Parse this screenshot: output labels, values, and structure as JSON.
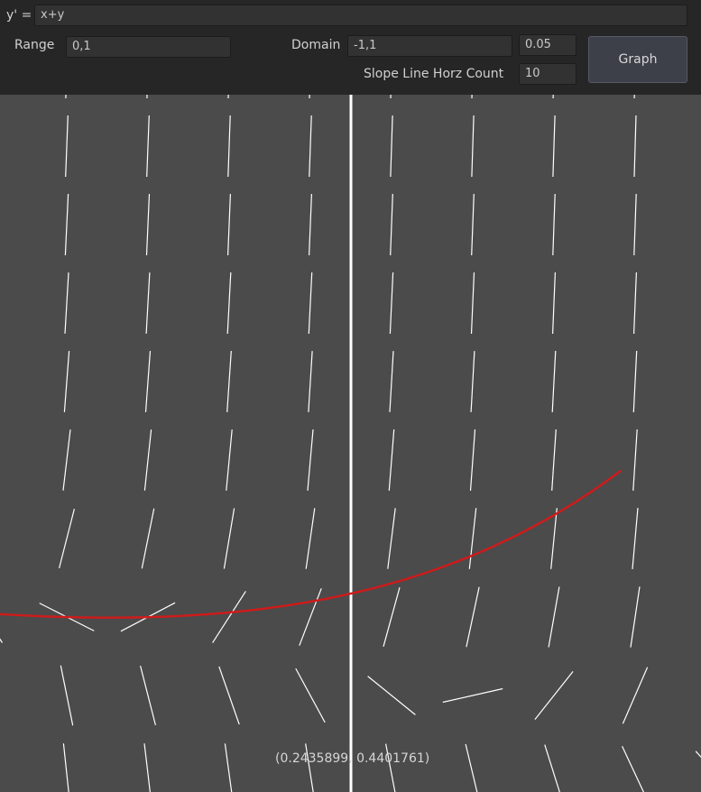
{
  "equation": {
    "prefix": "y' =",
    "value": "x+y"
  },
  "range": {
    "label": "Range",
    "value": "0,1"
  },
  "domain": {
    "label": "Domain",
    "value": "-1,1",
    "step": "0.05"
  },
  "slope_count": {
    "label": "Slope Line Horz Count",
    "value": "10"
  },
  "graph_button": {
    "label": "Graph"
  },
  "coordinate_readout": "(0.2435899, 0.4401761)",
  "colors": {
    "background": "#4b4b4b",
    "toolbar": "#262626",
    "slope_lines": "#ffffff",
    "solution_curve": "#d11a1a",
    "axis": "#ffffff"
  }
}
